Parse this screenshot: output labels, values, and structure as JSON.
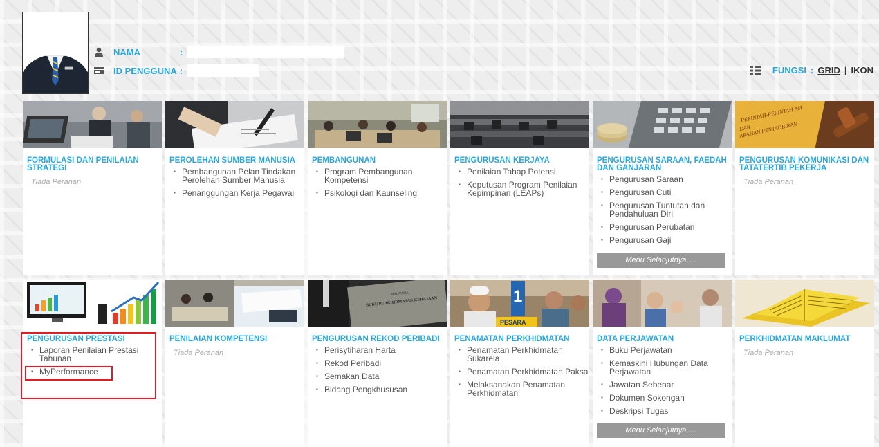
{
  "header": {
    "nama_label": "NAMA",
    "nama_colon": ":",
    "nama_value": "",
    "id_label": "ID PENGGUNA",
    "id_colon": ":",
    "id_value": "",
    "fungsi_label": "FUNGSI",
    "fungsi_colon": ":",
    "grid_label": "GRID",
    "separator": "|",
    "ikon_label": "IKON"
  },
  "colors": {
    "accent": "#2aa7dd",
    "highlight": "#e41b23",
    "more_button": "#999999"
  },
  "tiles": [
    {
      "title": "FORMULASI DAN PENILAIAN STRATEGI",
      "no_role": "Tiada Peranan",
      "items": [],
      "icon": "people-laptop-meeting-photo"
    },
    {
      "title": "PEROLEHAN SUMBER MANUSIA",
      "items": [
        "Pembangunan Pelan Tindakan Perolehan Sumber Manusia",
        "Penanggungan Kerja Pegawai"
      ],
      "icon": "signing-document-photo"
    },
    {
      "title": "PEMBANGUNAN",
      "items": [
        "Program Pembangunan Kompetensi",
        "Psikologi dan Kaunseling"
      ],
      "icon": "classroom-training-photo"
    },
    {
      "title": "PENGURUSAN KERJAYA",
      "items": [
        "Penilaian Tahap Potensi",
        "Keputusan Program Penilaian Kepimpinan (LEAPs)"
      ],
      "icon": "office-workers-photo"
    },
    {
      "title": "PENGURUSAN SARAAN, FAEDAH DAN GANJARAN",
      "items": [
        "Pengurusan Saraan",
        "Pengurusan Cuti",
        "Pengurusan Tuntutan dan Pendahuluan Diri",
        "Pengurusan Perubatan",
        "Pengurusan Gaji"
      ],
      "more": "Menu Selanjutnya ....",
      "icon": "calculator-coins-photo"
    },
    {
      "title": "PENGURUSAN KOMUNIKASI DAN TATATERTIB PEKERJA",
      "no_role": "Tiada Peranan",
      "items": [],
      "icon": "gavel-documents-photo",
      "photo_text": [
        "PERINTAH-PERINTAH AM",
        "DAN",
        "ARAHAN PENTADBIRAN"
      ]
    },
    {
      "title": "PENGURUSAN PRESTASI",
      "items": [
        "Laporan Penilaian Prestasi Tahunan",
        "MyPerformance"
      ],
      "icon": "performance-charts-photo"
    },
    {
      "title": "PENILAIAN KOMPETENSI",
      "no_role": "Tiada Peranan",
      "items": [],
      "icon": "interview-assessment-photo"
    },
    {
      "title": "PENGURUSAN REKOD PERIBADI",
      "items": [
        "Perisytiharan Harta",
        "Rekod Peribadi",
        "Semakan Data",
        "Bidang Pengkhususan"
      ],
      "icon": "service-record-book-photo",
      "photo_text": [
        "MALAYSIA",
        "BUKU PERKHIDMATAN KERAJAAN"
      ]
    },
    {
      "title": "PENAMATAN PERKHIDMATAN",
      "items": [
        "Penamatan Perkhidmatan Sukarela",
        "Penamatan Perkhidmatan Paksa",
        "Melaksanakan Penamatan Perkhidmatan"
      ],
      "icon": "pensioners-photo",
      "photo_text": [
        "1",
        "PESARA"
      ]
    },
    {
      "title": "DATA PERJAWATAN",
      "items": [
        "Buku Perjawatan",
        "Kemaskini Hubungan Data Perjawatan",
        "Jawatan Sebenar",
        "Dokumen Sokongan",
        "Deskripsi Tugas"
      ],
      "more": "Menu Selanjutnya ....",
      "icon": "family-photo"
    },
    {
      "title": "PERKHIDMATAN MAKLUMAT",
      "no_role": "Tiada Peranan",
      "items": [],
      "icon": "yellow-book-photo"
    }
  ]
}
